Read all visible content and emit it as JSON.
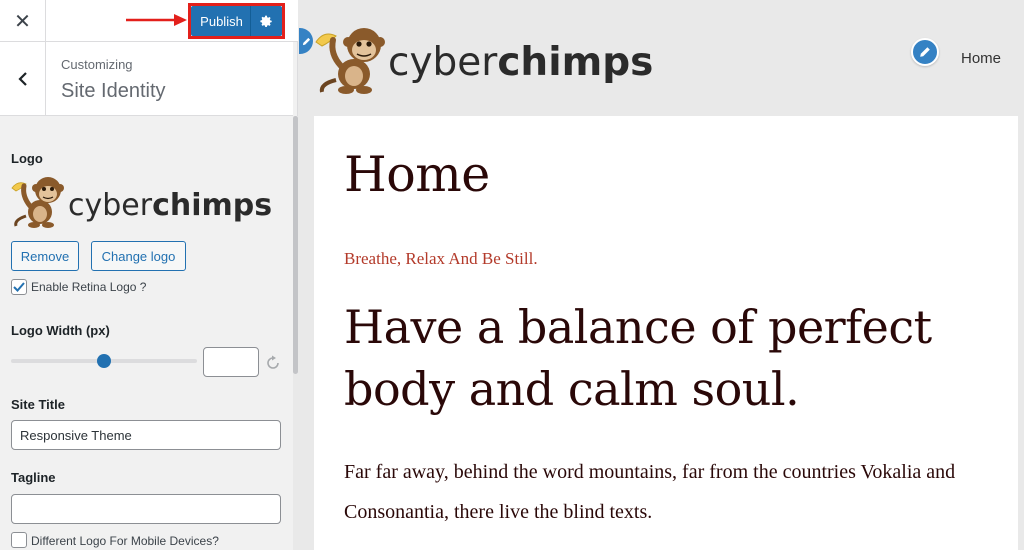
{
  "sidebar": {
    "close_icon": "close-icon",
    "publish_label": "Publish",
    "publish_settings_icon": "gear-icon",
    "back_icon": "chevron-left-icon",
    "customizing_label": "Customizing",
    "section_title": "Site Identity",
    "logo_label": "Logo",
    "logo_text_light": "cyber",
    "logo_text_bold": "chimps",
    "remove_label": "Remove",
    "change_logo_label": "Change logo",
    "retina_label": "Enable Retina Logo ?",
    "retina_checked": true,
    "logo_width_label": "Logo Width (px)",
    "logo_width_value": "",
    "slider_value_percent": 50,
    "site_title_label": "Site Title",
    "site_title_value": "Responsive Theme",
    "tagline_label": "Tagline",
    "tagline_value": "",
    "mobile_logo_label": "Different Logo For Mobile Devices?",
    "mobile_logo_checked": false
  },
  "preview": {
    "logo_text_light": "cyber",
    "logo_text_bold": "chimps",
    "nav_home": "Home",
    "page_title": "Home",
    "tagline": "Breathe, Relax And Be Still.",
    "headline": "Have a balance of perfect body and calm soul.",
    "body_text": "Far far away, behind the word mountains, far from the countries Vokalia and Consonantia, there live the blind texts."
  },
  "colors": {
    "accent": "#2271b1",
    "highlight": "#e3201b",
    "tagline": "#b33a2a",
    "heading": "#2a0808"
  }
}
